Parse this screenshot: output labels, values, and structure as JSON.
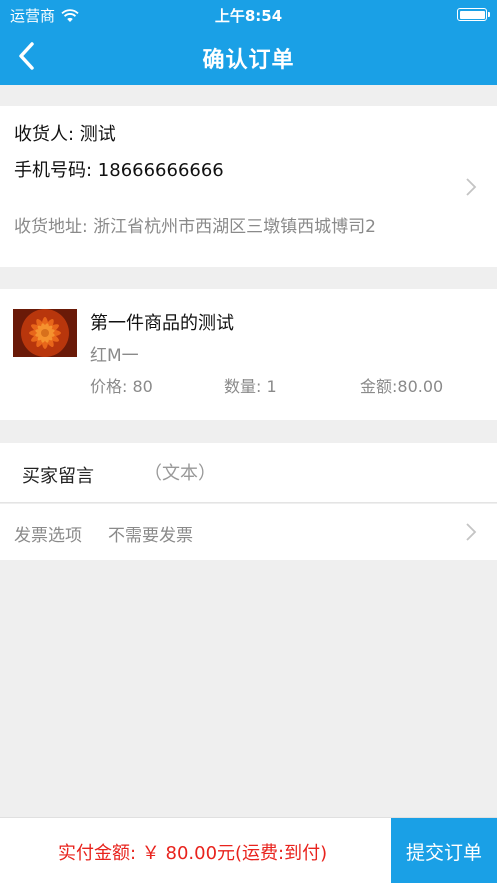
{
  "status_bar": {
    "carrier": "运营商",
    "time": "上午8:54"
  },
  "nav": {
    "title": "确认订单",
    "back_icon": "chevron-left-icon"
  },
  "address": {
    "name": "收货人: 测试",
    "phone": "手机号码: 18666666666",
    "detail": "收货地址: 浙江省杭州市西湖区三墩镇西城博司2"
  },
  "product": {
    "name": "第一件商品的测试",
    "spec": "红M一",
    "price": "价格: 80",
    "quantity": "数量: 1",
    "amount": "金额:80.00"
  },
  "message": {
    "label": "买家留言",
    "placeholder": "（文本）"
  },
  "invoice": {
    "label": "发票选项",
    "value": "不需要发票"
  },
  "footer": {
    "total": "实付金额: ￥ 80.00元(运费:到付)",
    "submit_label": "提交订单"
  },
  "colors": {
    "primary": "#1aa0e6",
    "price_red": "#e8231d"
  }
}
